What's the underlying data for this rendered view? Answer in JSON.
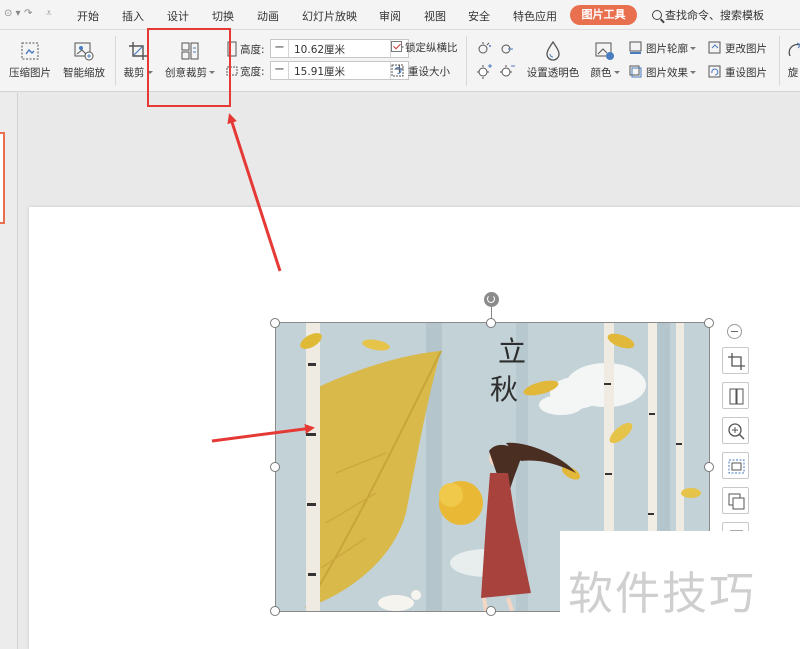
{
  "menu": {
    "items": [
      "开始",
      "插入",
      "设计",
      "切换",
      "动画",
      "幻灯片放映",
      "审阅",
      "视图",
      "安全",
      "特色应用"
    ],
    "active_tab": "图片工具",
    "search_label": "查找命令、搜索模板",
    "accent_color": "#e8704f"
  },
  "ribbon": {
    "compress_label": "压缩图片",
    "smart_zoom_label": "智能缩放",
    "crop_label": "裁剪",
    "creative_crop_label": "创意裁剪",
    "height_label": "高度:",
    "height_value": "10.62厘米",
    "width_label": "宽度:",
    "width_value": "15.91厘米",
    "minus_label": "−",
    "plus_label": "+",
    "lock_ratio_label": "锁定纵横比",
    "reset_size_label": "重设大小",
    "transparent_label": "设置透明色",
    "color_label": "颜色",
    "outline_label": "图片轮廓",
    "effect_label": "图片效果",
    "change_label": "更改图片",
    "reset_picture_label": "重设图片",
    "rotate_label": "旋"
  },
  "picture": {
    "title_char_1": "立",
    "title_char_2": "秋"
  },
  "highlight_color": "#e53935",
  "watermark": "软件技巧"
}
